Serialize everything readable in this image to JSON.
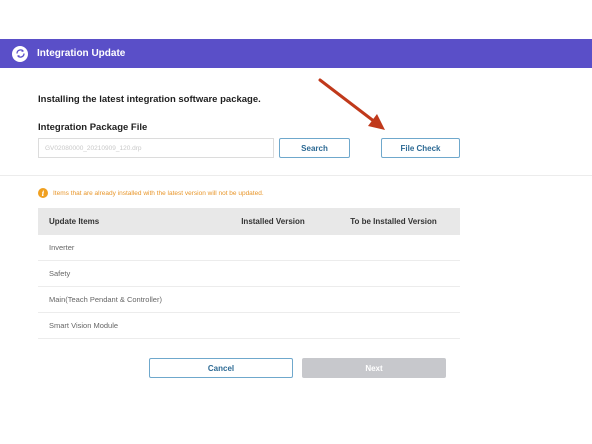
{
  "header": {
    "title": "Integration Update",
    "icon": "sync-icon",
    "color": "#5a4fc8"
  },
  "subtitle": "Installing the latest integration software package.",
  "package": {
    "label": "Integration Package File",
    "placeholder": "GV02080000_20210909_120.drp"
  },
  "buttons": {
    "search": "Search",
    "file_check": "File Check",
    "cancel": "Cancel",
    "next": "Next"
  },
  "notice": {
    "text": "Items that are already installed with the latest version will not be updated.",
    "color": "#e8962a"
  },
  "table": {
    "headers": [
      "Update Items",
      "Installed Version",
      "To be Installed Version"
    ],
    "rows": [
      {
        "item": "Inverter",
        "installed": "",
        "to_be_installed": ""
      },
      {
        "item": "Safety",
        "installed": "",
        "to_be_installed": ""
      },
      {
        "item": "Main(Teach Pendant & Controller)",
        "installed": "",
        "to_be_installed": ""
      },
      {
        "item": "Smart Vision Module",
        "installed": "",
        "to_be_installed": ""
      }
    ]
  },
  "annotation": {
    "arrow_color": "#c0391b"
  }
}
